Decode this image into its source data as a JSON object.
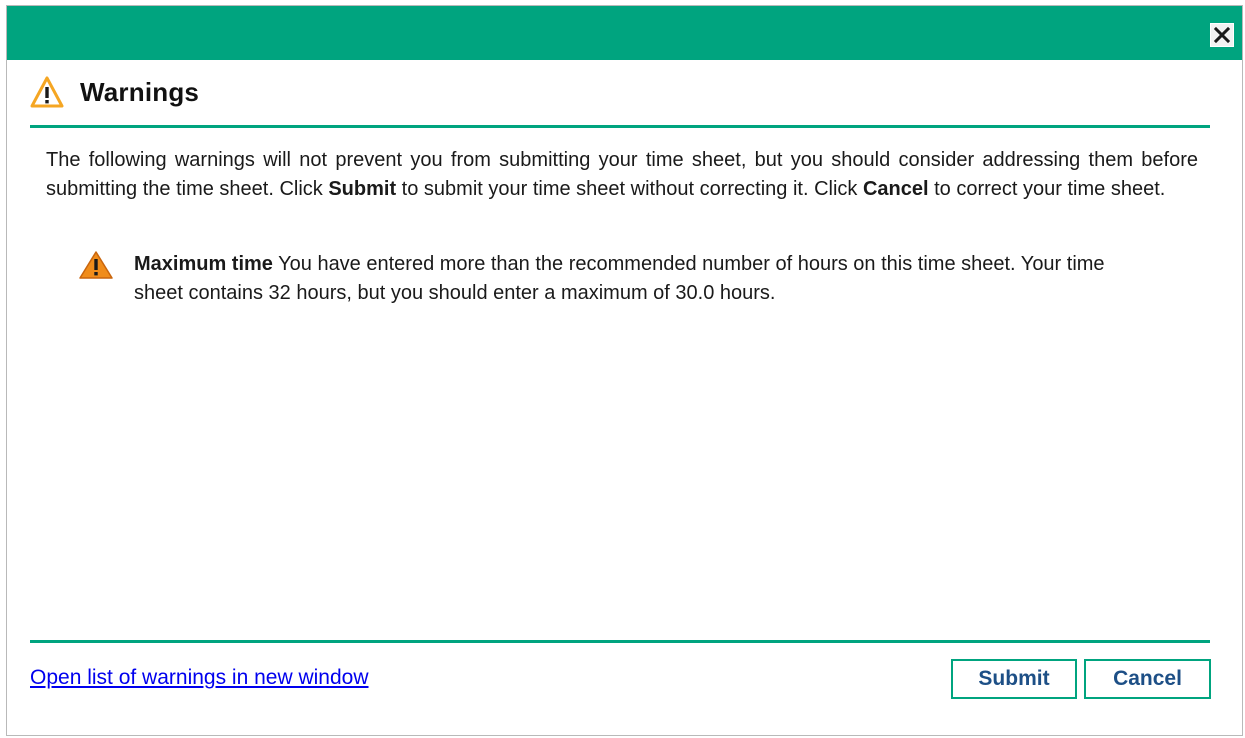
{
  "dialog": {
    "close_icon": "close-icon",
    "title": "Warnings",
    "title_icon": "warning-outline-icon",
    "intro": {
      "part1": "The following warnings will not prevent you from submitting your time sheet, but you should consider addressing them before submitting the time sheet. Click ",
      "submit_word": "Submit",
      "part2": " to submit your time sheet without correcting it. Click ",
      "cancel_word": "Cancel",
      "part3": " to correct your time sheet."
    },
    "warnings": [
      {
        "icon": "warning-filled-icon",
        "title": "Maximum time",
        "message": " You have entered more than the recommended number of hours on this time sheet. Your time sheet contains 32 hours, but you should enter a maximum of 30.0 hours."
      }
    ],
    "footer": {
      "link_label": "Open list of warnings in new window",
      "submit_label": "Submit",
      "cancel_label": "Cancel"
    },
    "colors": {
      "accent": "#00a47f",
      "button_text": "#1d4f86",
      "link": "#0000ee",
      "warning_orange": "#f08c1a"
    }
  }
}
